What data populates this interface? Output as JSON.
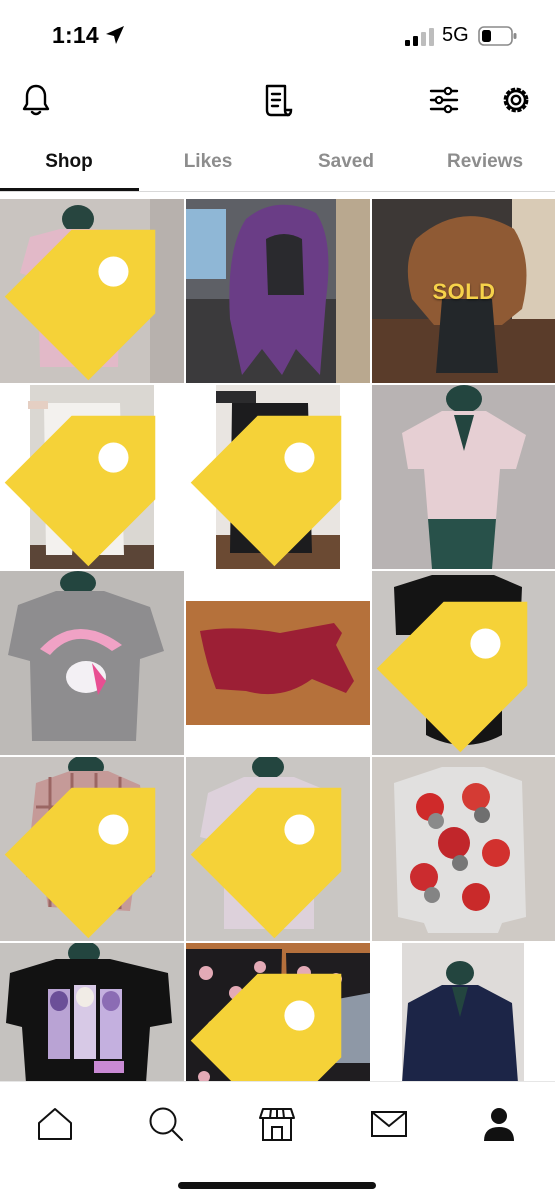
{
  "status_bar": {
    "time": "1:14",
    "network": "5G"
  },
  "toolbar": {
    "icons": [
      "bell-icon",
      "clipboard-icon",
      "filter-sliders-icon",
      "gear-icon"
    ]
  },
  "tabs": [
    {
      "label": "Shop",
      "active": true
    },
    {
      "label": "Likes",
      "active": false
    },
    {
      "label": "Saved",
      "active": false
    },
    {
      "label": "Reviews",
      "active": false
    }
  ],
  "listings": [
    {
      "item": "pink graphic tee",
      "price_tag": true
    },
    {
      "item": "purple wig",
      "price_tag": false
    },
    {
      "item": "brown short wig",
      "price_tag": false,
      "badge": "SOLD"
    },
    {
      "item": "white pants",
      "price_tag": true
    },
    {
      "item": "black pants",
      "price_tag": true
    },
    {
      "item": "pink collared crop top",
      "price_tag": false
    },
    {
      "item": "gray My Little Pony crop tee",
      "price_tag": false
    },
    {
      "item": "red bodysuit",
      "price_tag": false
    },
    {
      "item": "black keyhole bodysuit",
      "price_tag": true
    },
    {
      "item": "pink plaid shirt",
      "price_tag": true
    },
    {
      "item": "lavender My Little Pony tee",
      "price_tag": true
    },
    {
      "item": "cat print sweatshirt",
      "price_tag": false
    },
    {
      "item": "black Bratz crop tee",
      "price_tag": false
    },
    {
      "item": "black floral top",
      "price_tag": true
    },
    {
      "item": "navy blouse",
      "price_tag": false
    }
  ],
  "bottom_nav": {
    "items": [
      "home-icon",
      "search-icon",
      "shop-icon",
      "mail-icon",
      "profile-icon"
    ]
  },
  "colors": {
    "price_tag": "#f5d238",
    "sold_text": "#f6d24a",
    "active_tab": "#111111",
    "inactive_tab": "#8d8d8d"
  }
}
